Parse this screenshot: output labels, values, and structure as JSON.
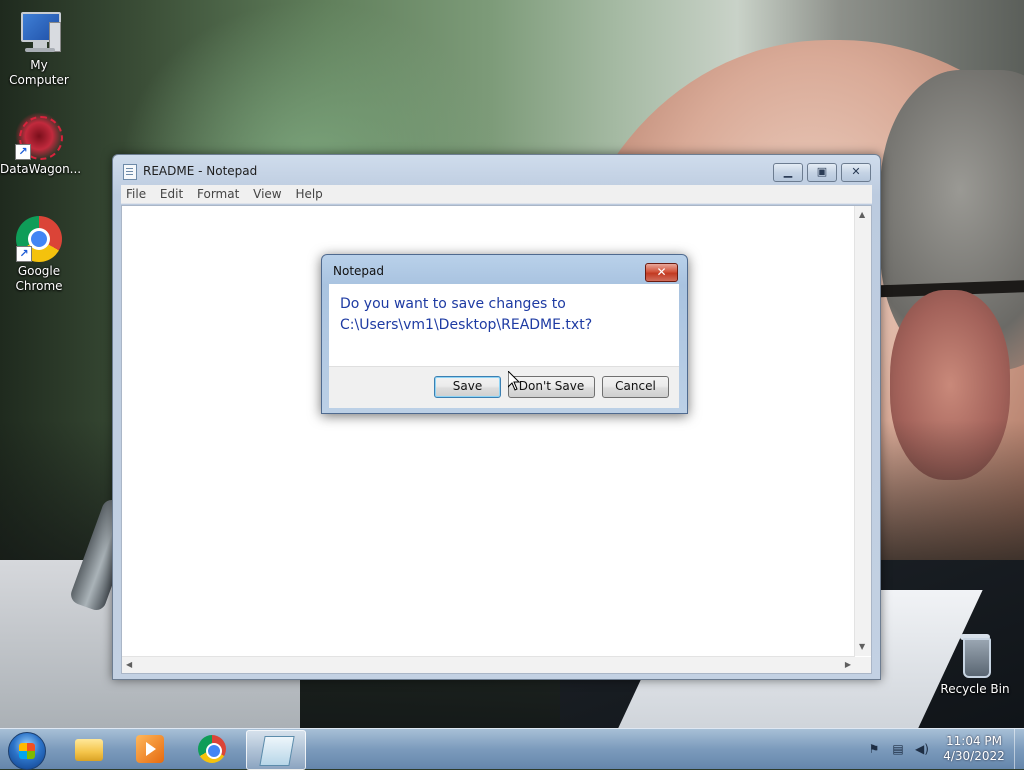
{
  "desktop": {
    "icons": [
      {
        "label": "My Computer",
        "icon": "computer-icon"
      },
      {
        "label": "DataWagon...",
        "icon": "datawagon-icon"
      },
      {
        "label": "Google Chrome",
        "icon": "chrome-icon"
      },
      {
        "label": "Recycle Bin",
        "icon": "recycle-bin-icon"
      }
    ]
  },
  "notepad": {
    "title": "README - Notepad",
    "menu": [
      "File",
      "Edit",
      "Format",
      "View",
      "Help"
    ],
    "content": "",
    "caption_buttons": {
      "minimize": "minimize-icon",
      "maximize": "maximize-icon",
      "close": "close-icon"
    }
  },
  "dialog": {
    "title": "Notepad",
    "message_line1": "Do you want to save changes to",
    "message_line2": "C:\\Users\\vm1\\Desktop\\README.txt?",
    "buttons": {
      "save": "Save",
      "dont_save": "Don't Save",
      "cancel": "Cancel"
    },
    "default_button": "Save",
    "close_glyph": "✕"
  },
  "taskbar": {
    "pinned": [
      {
        "name": "explorer",
        "icon": "folder-icon",
        "active": false
      },
      {
        "name": "media-player",
        "icon": "media-player-icon",
        "active": false
      },
      {
        "name": "chrome",
        "icon": "chrome-icon",
        "active": false
      },
      {
        "name": "notepad",
        "icon": "notepad-icon",
        "active": true
      }
    ],
    "tray_icons": [
      "action-center-flag-icon",
      "network-icon",
      "volume-icon"
    ],
    "clock": {
      "time": "11:04 PM",
      "date": "4/30/2022"
    }
  },
  "colors": {
    "dialog_message": "#1e3ba3",
    "close_red": "#c23a22",
    "taskbar": "#80a0c4"
  }
}
